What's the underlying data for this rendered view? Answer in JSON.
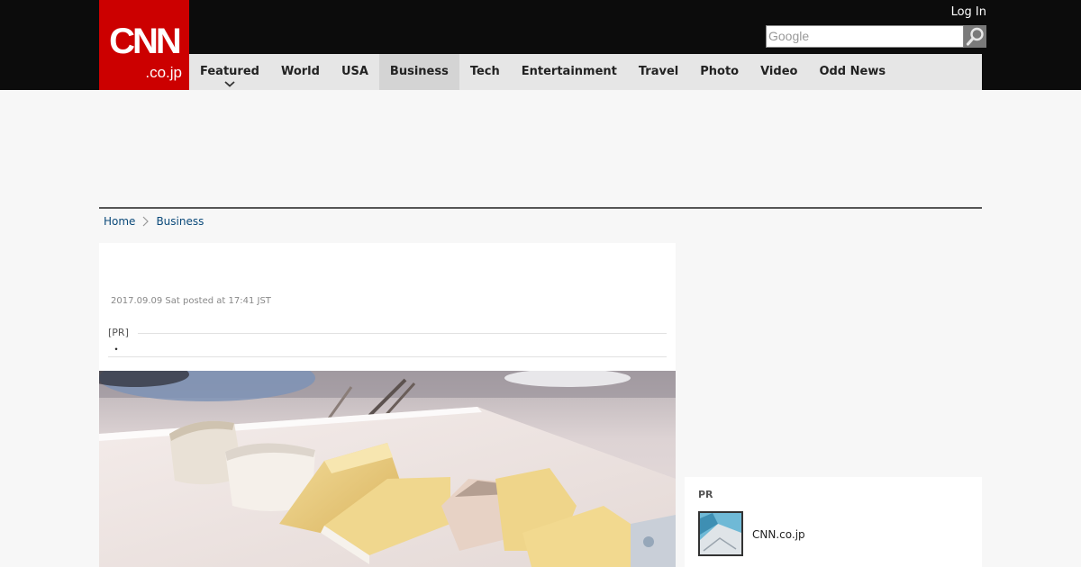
{
  "header": {
    "logo_main": "CNN",
    "logo_sub": ".co.jp",
    "login_label": "Log In",
    "search_placeholder": "Google"
  },
  "nav": {
    "items": [
      {
        "label": "Featured"
      },
      {
        "label": "World"
      },
      {
        "label": "USA"
      },
      {
        "label": "Business"
      },
      {
        "label": "Tech"
      },
      {
        "label": "Entertainment"
      },
      {
        "label": "Travel"
      },
      {
        "label": "Photo"
      },
      {
        "label": "Video"
      },
      {
        "label": "Odd News"
      }
    ],
    "active": "Business"
  },
  "breadcrumb": {
    "home": "Home",
    "current": "Business"
  },
  "article": {
    "dateline": "2017.09.09 Sat posted at 17:41 JST",
    "pr_tag": "[PR]",
    "pr_text": "・"
  },
  "sidebar": {
    "pr_label": "PR",
    "pr_item": "CNN.co.jp"
  },
  "colors": {
    "brand": "#cc0000",
    "topbar": "#0c0c0c",
    "nav_bg": "#e6e6e6",
    "link": "#0b4a7a"
  },
  "icons": {
    "search": "magnifier-icon",
    "featured_menu": "chevron-down-icon",
    "breadcrumb_separator": "chevron-right-icon"
  }
}
